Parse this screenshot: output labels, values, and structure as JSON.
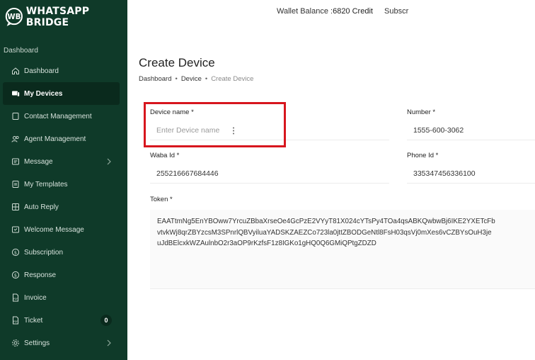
{
  "brand": {
    "name": "WHATSAPP BRIDGE",
    "logo_letters": "WB"
  },
  "sidebar": {
    "section_label": "Dashboard",
    "items": [
      {
        "label": "Dashboard",
        "icon": "home-icon",
        "active": false
      },
      {
        "label": "My Devices",
        "icon": "devices-icon",
        "active": true
      },
      {
        "label": "Contact Management",
        "icon": "contact-icon",
        "active": false
      },
      {
        "label": "Agent Management",
        "icon": "users-icon",
        "active": false
      },
      {
        "label": "Message",
        "icon": "message-icon",
        "active": false,
        "expandable": true
      },
      {
        "label": "My Templates",
        "icon": "template-icon",
        "active": false
      },
      {
        "label": "Auto Reply",
        "icon": "grid-icon",
        "active": false
      },
      {
        "label": "Welcome Message",
        "icon": "welcome-icon",
        "active": false
      },
      {
        "label": "Subscription",
        "icon": "dollar-icon",
        "active": false
      },
      {
        "label": "Response",
        "icon": "dollar-icon",
        "active": false
      },
      {
        "label": "Invoice",
        "icon": "pdf-icon",
        "active": false
      },
      {
        "label": "Ticket",
        "icon": "ticket-icon",
        "active": false,
        "badge": "0"
      },
      {
        "label": "Settings",
        "icon": "gear-icon",
        "active": false,
        "expandable": true
      }
    ]
  },
  "header": {
    "wallet_label": "Wallet Balance :",
    "wallet_value": "6820 Credit",
    "subscription_label": "Subscr"
  },
  "page": {
    "title": "Create Device",
    "breadcrumb": [
      "Dashboard",
      "Device",
      "Create Device"
    ]
  },
  "form": {
    "device_name": {
      "label": "Device name *",
      "placeholder": "Enter Device name",
      "value": ""
    },
    "number": {
      "label": "Number *",
      "value": "1555-600-3062"
    },
    "waba_id": {
      "label": "Waba Id *",
      "value": "255216667684446"
    },
    "phone_id": {
      "label": "Phone Id *",
      "value": "335347456336100"
    },
    "token": {
      "label": "Token *",
      "lines": [
        "EAATtmNg5EnYBOww7YrcuZBbaXrseOe4GcPzE2VYyT81X024cYTsPy4TOa4qsABKQwbwBj6IKE2YXETcFb",
        "vtvkWj8qrZBYzcsM3SPnrlQBVyiluaYADSKZAEZCo723la0jttZBODGeNtl8FsH03qsVj0mXes6vCZBYsOuH3je",
        "uJdBElcxkWZAulnbO2r3aOP9rKzfsF1z8IGKo1gHQ0Q6GMiQPtgZDZD"
      ]
    }
  },
  "colors": {
    "sidebar_bg": "#0f3a29",
    "active_item_bg": "#0a2a1d",
    "highlight_border": "#d7161e"
  }
}
